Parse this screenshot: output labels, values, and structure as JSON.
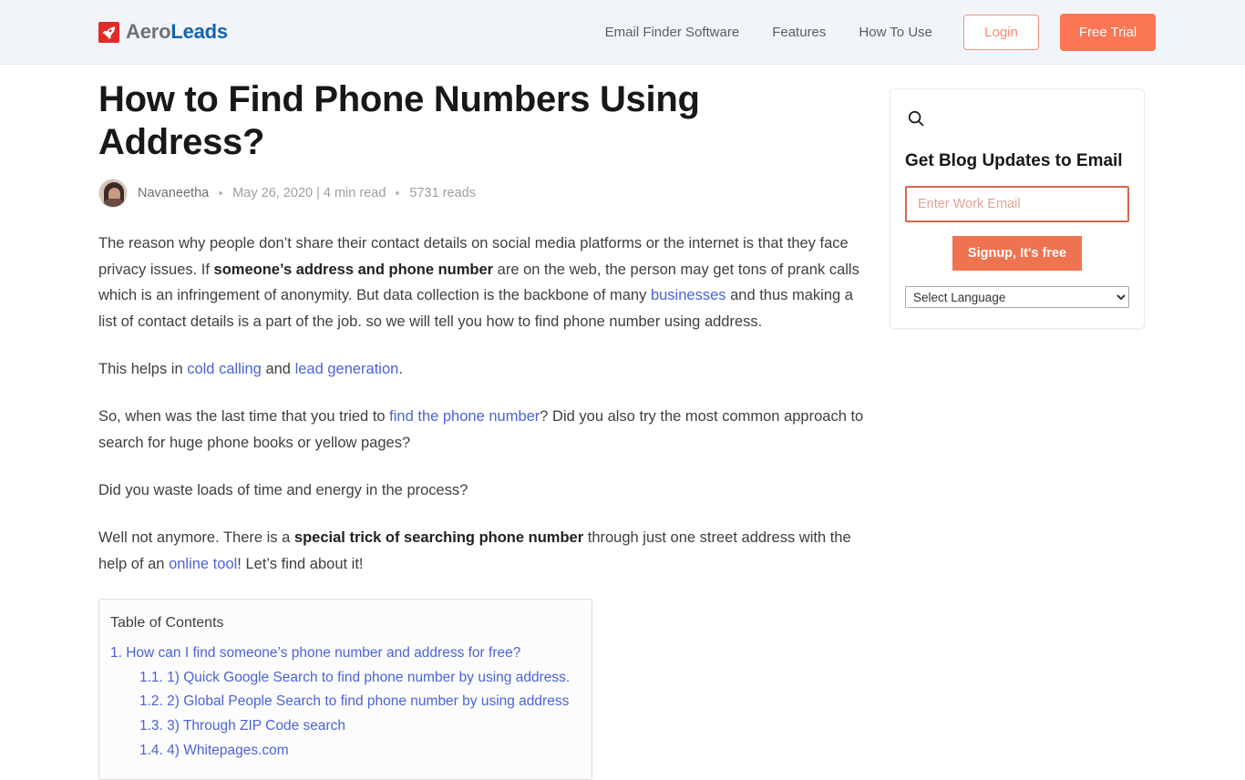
{
  "header": {
    "brand": {
      "part1": "Aero",
      "part2": "Leads",
      "icon": "rocket-icon"
    },
    "nav": [
      {
        "label": "Email Finder Software"
      },
      {
        "label": "Features"
      },
      {
        "label": "How To Use"
      }
    ],
    "login_label": "Login",
    "trial_label": "Free Trial",
    "colors": {
      "accent": "#fb7654",
      "brand_blue": "#1563ad",
      "logo_red": "#e02b2b"
    }
  },
  "article": {
    "title": "How to Find Phone Numbers Using Address?",
    "meta": {
      "author": "Navaneetha",
      "date": "May 26, 2020",
      "read_time": "4 min read",
      "date_read": "May 26, 2020 | 4 min read",
      "reads": "5731 reads"
    },
    "paragraphs": {
      "p1_a": "The reason why people don’t share their contact details on social media platforms or the internet is that they face privacy issues. If ",
      "p1_bold": "someone’s address and phone number",
      "p1_b": " are on the web, the person may get tons of prank calls which is an infringement of anonymity. But data collection is the backbone of many ",
      "p1_link": "businesses",
      "p1_c": " and thus making a list of contact details is a part of the job. so we will tell you how to find phone number using address.",
      "p2_a": "This helps in ",
      "p2_link1": "cold calling",
      "p2_b": " and ",
      "p2_link2": "lead generation",
      "p2_c": ".",
      "p3_a": "So, when was the last time that you tried to ",
      "p3_link": "find the phone number",
      "p3_b": "? Did you also try the most common approach to search for huge phone books or yellow pages?",
      "p4": "Did you waste loads of time and energy in the process?",
      "p5_a": "Well not anymore. There is a ",
      "p5_bold": "special trick of searching phone number",
      "p5_b": " through just one street address with the help of an ",
      "p5_link": "online tool",
      "p5_c": "! Let’s find about it!"
    }
  },
  "toc": {
    "title": "Table of Contents",
    "items": [
      {
        "label": "1. How can I find someone’s phone number and address for free?",
        "level": 1
      },
      {
        "label": "1.1. 1) Quick Google Search to find phone number by using address.",
        "level": 2
      },
      {
        "label": "1.2. 2) Global People Search to find phone number by using address",
        "level": 2
      },
      {
        "label": "1.3. 3) Through ZIP Code search",
        "level": 2
      },
      {
        "label": "1.4. 4) Whitepages.com",
        "level": 2
      }
    ]
  },
  "sidebar": {
    "search_icon": "search-icon",
    "heading": "Get Blog Updates to Email",
    "email_placeholder": "Enter Work Email",
    "email_value": "",
    "signup_label": "Signup, It's free",
    "language_selected": "Select Language",
    "language_options": [
      "Select Language"
    ]
  }
}
